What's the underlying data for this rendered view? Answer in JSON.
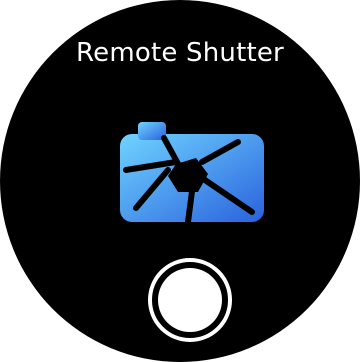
{
  "app": {
    "title": "Remote Shutter"
  },
  "icons": {
    "main_icon": "camera-aperture-icon",
    "action_icon": "shutter-button-icon"
  },
  "colors": {
    "background": "#000000",
    "text": "#ffffff",
    "icon_light": "#5ec8ff",
    "icon_dark": "#2f6de0",
    "shutter": "#ffffff"
  }
}
